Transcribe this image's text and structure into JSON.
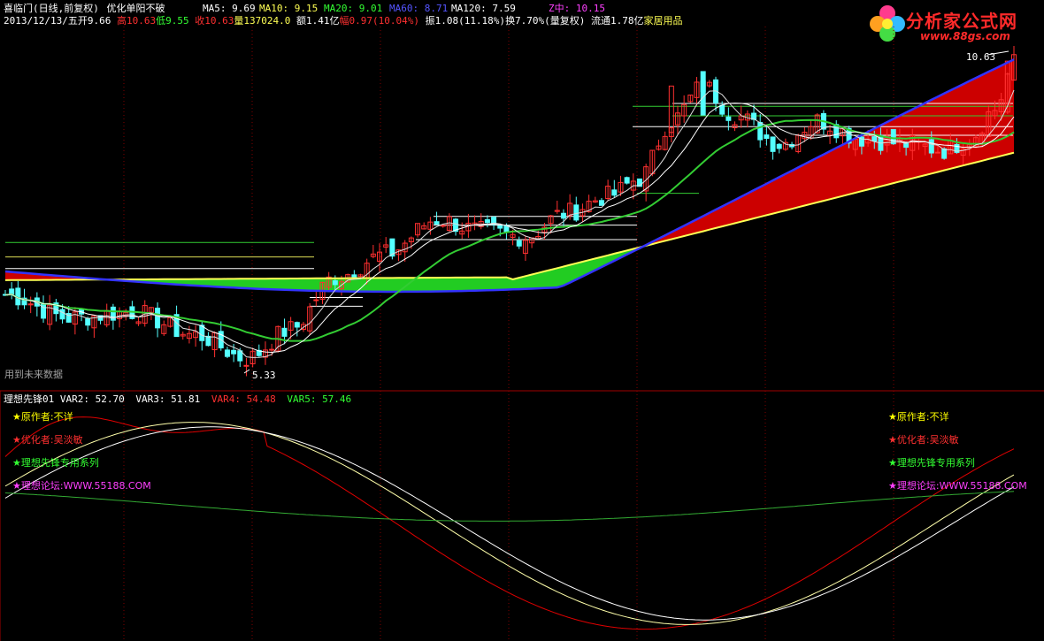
{
  "header": {
    "title": "喜临门(日线,前复权)",
    "formula": "优化单阳不破",
    "ma5": "MA5: 9.69",
    "ma10": "MA10: 9.15",
    "ma20": "MA20: 9.01",
    "ma60": "MA60: 8.71",
    "ma120": "MA120: 7.59",
    "zmid": "Z中: 10.15",
    "date": "2013/12/13/五",
    "open": "开9.66",
    "high": "高10.63",
    "low": "低9.55",
    "close": "收10.63",
    "volume": "量137024.0",
    "amount": "额1.41亿",
    "change": "幅0.97(10.04%)",
    "amplitude": "振1.08(11.18%)",
    "turnover": "换7.70%(量复权)",
    "float": "流通1.78亿",
    "industry": "家居用品"
  },
  "price_labels": {
    "max": "10.63",
    "min": "5.33"
  },
  "future_data_note": "用到未来数据",
  "indicator": {
    "name": "理想先锋01",
    "var2": "VAR2: 52.70",
    "var3": "VAR3: 51.81",
    "var4": "VAR4: 54.48",
    "var5": "VAR5: 57.46"
  },
  "notes": [
    {
      "star": "★",
      "text": "原作者:不详",
      "color": "#ffff00"
    },
    {
      "star": "★",
      "text": "优化者:吴淡敏",
      "color": "#ff3030"
    },
    {
      "star": "★",
      "text": "理想先锋专用系列",
      "color": "#33ff33"
    },
    {
      "star": "★",
      "text": "理想论坛:WWW.55188.COM",
      "color": "#ff40ff"
    }
  ],
  "logo": {
    "name": "分析家公式网",
    "url": "www.88gs.com"
  },
  "colors": {
    "up": "#ff3030",
    "down": "#54ffff",
    "ma_white": "#ffffff",
    "ma_yellow": "#ffff54",
    "ma_green": "#33cc33",
    "ma_blue": "#3333ff",
    "bg": "#000000",
    "grid": "#800000"
  }
}
